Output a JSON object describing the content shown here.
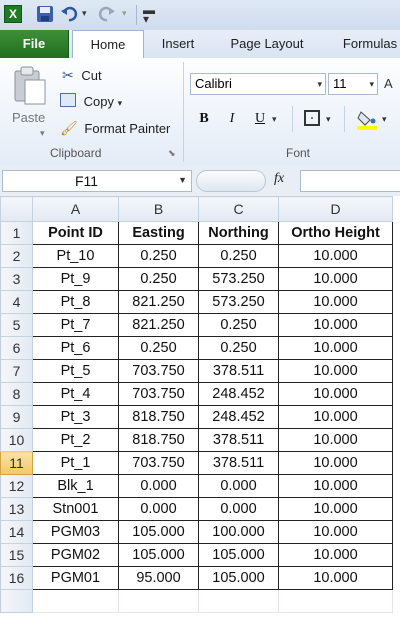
{
  "quick_access": {
    "icons": [
      "excel-icon",
      "save-icon",
      "undo-icon",
      "redo-icon",
      "customize-icon"
    ]
  },
  "tabs": [
    "File",
    "Home",
    "Insert",
    "Page Layout",
    "Formulas"
  ],
  "ribbon": {
    "clipboard": {
      "paste": "Paste",
      "cut": "Cut",
      "copy": "Copy",
      "format_painter": "Format Painter",
      "group": "Clipboard"
    },
    "font": {
      "name": "Calibri",
      "size": "11",
      "group": "Font"
    }
  },
  "formula_bar": {
    "name_box": "F11",
    "fx": "fx",
    "value": ""
  },
  "colors": {
    "accent": "#1f6e1d",
    "selected_header": "#f2c867"
  },
  "columns": [
    "A",
    "B",
    "C",
    "D"
  ],
  "selected_row": "11",
  "rows": [
    {
      "n": "1",
      "cells": [
        "Point ID",
        "Easting",
        "Northing",
        "Ortho Height"
      ]
    },
    {
      "n": "2",
      "cells": [
        "Pt_10",
        "0.250",
        "0.250",
        "10.000"
      ]
    },
    {
      "n": "3",
      "cells": [
        "Pt_9",
        "0.250",
        "573.250",
        "10.000"
      ]
    },
    {
      "n": "4",
      "cells": [
        "Pt_8",
        "821.250",
        "573.250",
        "10.000"
      ]
    },
    {
      "n": "5",
      "cells": [
        "Pt_7",
        "821.250",
        "0.250",
        "10.000"
      ]
    },
    {
      "n": "6",
      "cells": [
        "Pt_6",
        "0.250",
        "0.250",
        "10.000"
      ]
    },
    {
      "n": "7",
      "cells": [
        "Pt_5",
        "703.750",
        "378.511",
        "10.000"
      ]
    },
    {
      "n": "8",
      "cells": [
        "Pt_4",
        "703.750",
        "248.452",
        "10.000"
      ]
    },
    {
      "n": "9",
      "cells": [
        "Pt_3",
        "818.750",
        "248.452",
        "10.000"
      ]
    },
    {
      "n": "10",
      "cells": [
        "Pt_2",
        "818.750",
        "378.511",
        "10.000"
      ]
    },
    {
      "n": "11",
      "cells": [
        "Pt_1",
        "703.750",
        "378.511",
        "10.000"
      ]
    },
    {
      "n": "12",
      "cells": [
        "Blk_1",
        "0.000",
        "0.000",
        "10.000"
      ]
    },
    {
      "n": "13",
      "cells": [
        "Stn001",
        "0.000",
        "0.000",
        "10.000"
      ]
    },
    {
      "n": "14",
      "cells": [
        "PGM03",
        "105.000",
        "100.000",
        "10.000"
      ]
    },
    {
      "n": "15",
      "cells": [
        "PGM02",
        "105.000",
        "105.000",
        "10.000"
      ]
    },
    {
      "n": "16",
      "cells": [
        "PGM01",
        "95.000",
        "105.000",
        "10.000"
      ]
    }
  ]
}
